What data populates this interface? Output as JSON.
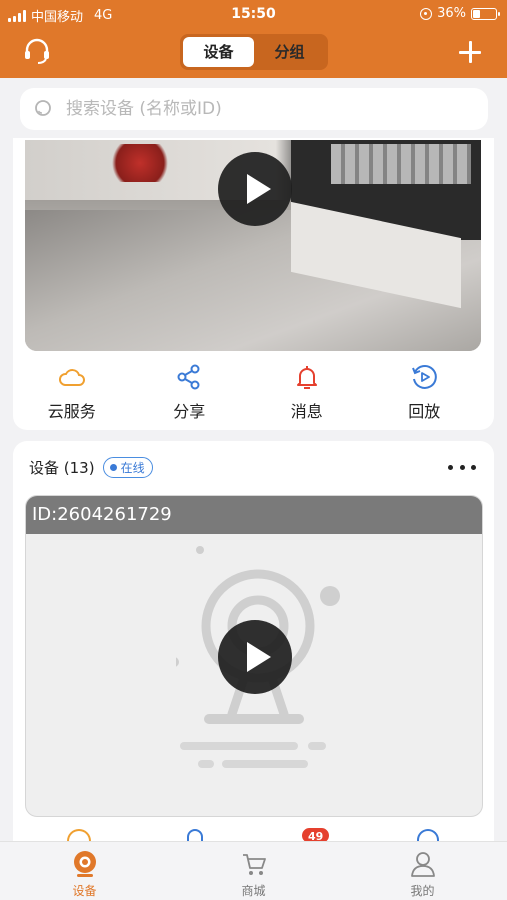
{
  "status_bar": {
    "carrier": "中国移动",
    "network": "4G",
    "time": "15:50",
    "battery": "36%",
    "battery_level": 0.36
  },
  "header": {
    "tabs": [
      {
        "label": "设备",
        "active": true
      },
      {
        "label": "分组",
        "active": false
      }
    ],
    "icons": {
      "left": "headset-icon",
      "right": "plus-icon"
    },
    "accent_color": "#e0782a"
  },
  "search": {
    "placeholder": "搜索设备 (名称或ID)"
  },
  "featured_card": {
    "actions": [
      {
        "label": "云服务",
        "icon": "cloud-icon",
        "color": "#f0a030"
      },
      {
        "label": "分享",
        "icon": "share-icon",
        "color": "#3a7ad6"
      },
      {
        "label": "消息",
        "icon": "bell-icon",
        "color": "#e5402e"
      },
      {
        "label": "回放",
        "icon": "replay-icon",
        "color": "#3a7ad6"
      }
    ]
  },
  "devices_card": {
    "title": "设备 (13)",
    "status_badge": "在线",
    "device_id": "ID:2604261729",
    "notification_count": "49"
  },
  "tab_bar": {
    "items": [
      {
        "label": "设备",
        "icon": "camera-icon",
        "active": true
      },
      {
        "label": "商城",
        "icon": "cart-icon",
        "active": false
      },
      {
        "label": "我的",
        "icon": "user-icon",
        "active": false
      }
    ]
  }
}
